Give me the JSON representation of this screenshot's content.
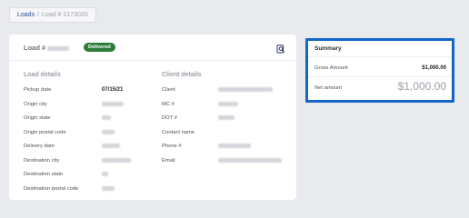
{
  "breadcrumb": {
    "root": "Loads",
    "separator": "/",
    "current": "Load # 2173020"
  },
  "load_card": {
    "title_prefix": "Load #",
    "status": "Delivered",
    "header_icon": "magnifier-document-icon",
    "load_details": {
      "title": "Load details",
      "rows": [
        {
          "label": "Pickup date",
          "value": "07/15/21"
        },
        {
          "label": "Origin city",
          "value": ""
        },
        {
          "label": "Origin state",
          "value": ""
        },
        {
          "label": "Origin postal code",
          "value": ""
        },
        {
          "label": "Delivery date",
          "value": ""
        },
        {
          "label": "Destination city",
          "value": ""
        },
        {
          "label": "Destination state",
          "value": ""
        },
        {
          "label": "Destination postal code",
          "value": ""
        }
      ]
    },
    "client_details": {
      "title": "Client details",
      "rows": [
        {
          "label": "Client",
          "value": ""
        },
        {
          "label": "MC #",
          "value": ""
        },
        {
          "label": "DOT #",
          "value": ""
        },
        {
          "label": "Contact name",
          "value": ""
        },
        {
          "label": "Phone #",
          "value": ""
        },
        {
          "label": "Email",
          "value": ""
        }
      ]
    }
  },
  "summary": {
    "title": "Summary",
    "gross_label": "Gross Amount",
    "gross_value": "$1,000.00",
    "net_label": "Net amount",
    "net_value": "$1,000.00",
    "highlight_color": "#1166c8"
  },
  "colors": {
    "status_badge": "#2c7c3c",
    "link": "#1f4e8c",
    "page_bg": "#e9eaee"
  }
}
